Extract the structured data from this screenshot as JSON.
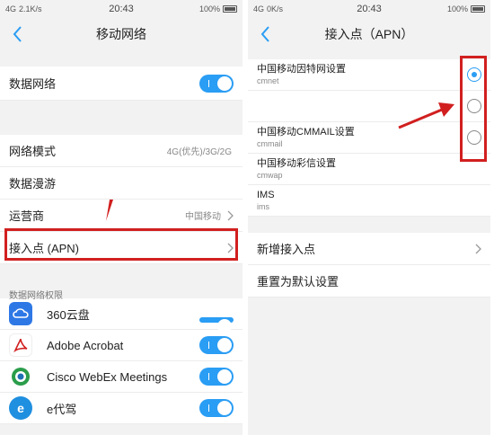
{
  "left": {
    "status": {
      "signal": "4G",
      "speed": "2.1K/s",
      "time": "20:43",
      "battery": "100%"
    },
    "title": "移动网络",
    "data_network": {
      "label": "数据网络",
      "enabled": true
    },
    "network_settings": [
      {
        "label": "网络模式",
        "value": "4G(优先)/3G/2G"
      },
      {
        "label": "数据漫游",
        "value": ""
      },
      {
        "label": "运营商",
        "value": "中国移动"
      },
      {
        "label": "接入点 (APN)",
        "value": ""
      }
    ],
    "permissions_header": "数据网络权限",
    "apps": [
      {
        "name": "360云盘",
        "enabled": true,
        "icon": "cloud-icon",
        "color": "#2e78e6"
      },
      {
        "name": "Adobe Acrobat",
        "enabled": true,
        "icon": "acrobat-icon",
        "color": "#d11f1f"
      },
      {
        "name": "Cisco WebEx Meetings",
        "enabled": true,
        "icon": "webex-icon",
        "color": "#2a9d4a"
      },
      {
        "name": "e代驾",
        "enabled": true,
        "icon": "e-icon",
        "color": "#1f8fe0"
      }
    ]
  },
  "right": {
    "status": {
      "signal": "4G",
      "speed": "0K/s",
      "time": "20:43",
      "battery": "100%"
    },
    "title": "接入点（APN）",
    "apns": [
      {
        "name": "中国移动因特网设置",
        "sub": "cmnet",
        "selected": true
      },
      {
        "name": "",
        "sub": "",
        "selected": false
      },
      {
        "name": "中国移动CMMAIL设置",
        "sub": "cmmail",
        "selected": false
      },
      {
        "name": "中国移动彩信设置",
        "sub": "cmwap",
        "selected": null
      },
      {
        "name": "IMS",
        "sub": "ims",
        "selected": null
      }
    ],
    "actions": [
      {
        "label": "新增接入点"
      },
      {
        "label": "重置为默认设置"
      }
    ]
  },
  "accent_color": "#2a9df4",
  "highlight_color": "#d11f1f"
}
